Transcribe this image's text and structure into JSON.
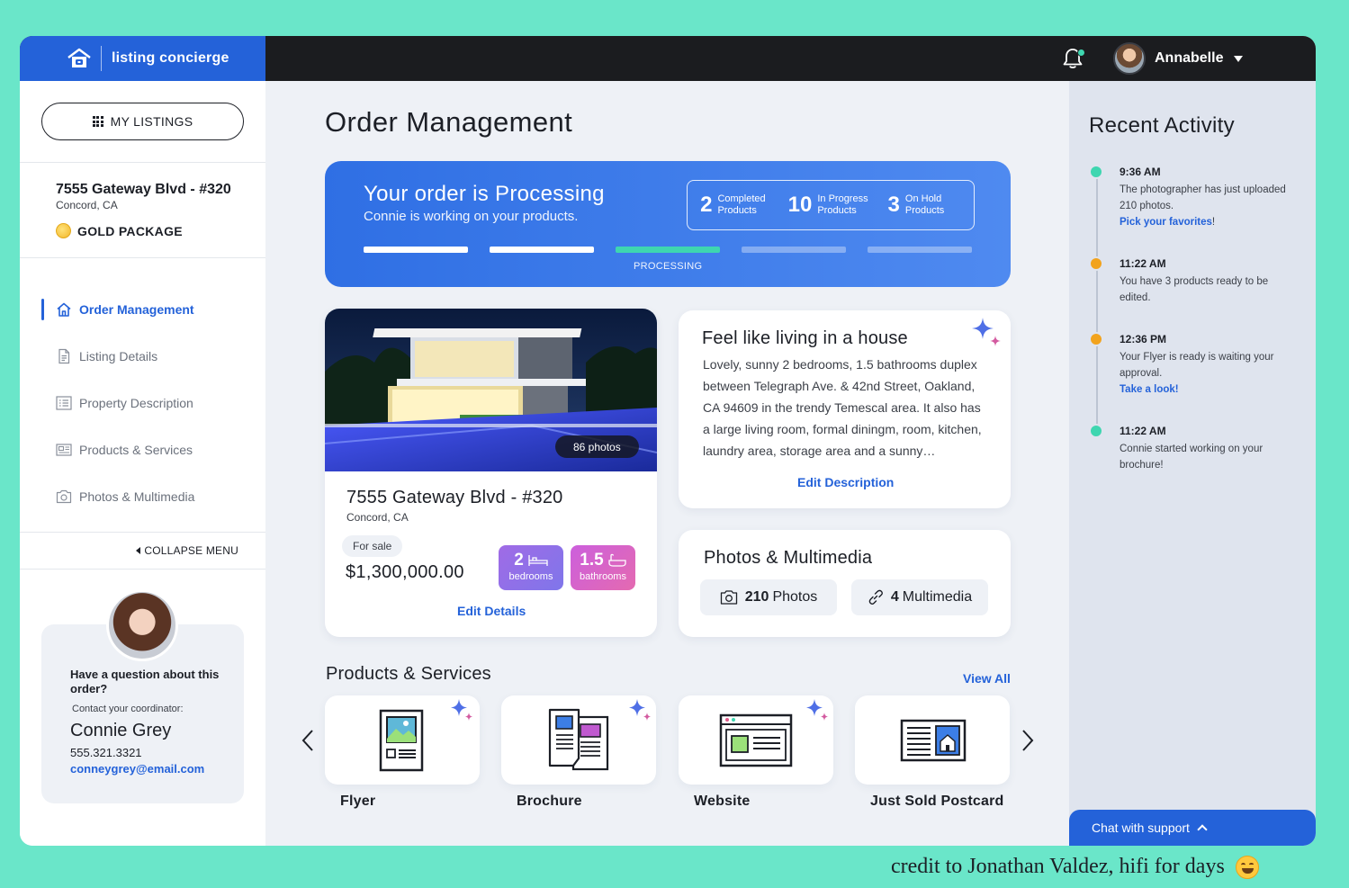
{
  "brand": {
    "name": "listing concierge"
  },
  "header": {
    "user_name": "Annabelle"
  },
  "sidebar": {
    "my_listings_label": "MY LISTINGS",
    "address": "7555 Gateway Blvd - #320",
    "city": "Concord, CA",
    "package": "GOLD PACKAGE",
    "nav": [
      {
        "label": "Order Management",
        "icon": "home-icon",
        "active": true
      },
      {
        "label": "Listing Details",
        "icon": "document-icon"
      },
      {
        "label": "Property Description",
        "icon": "list-icon"
      },
      {
        "label": "Products & Services",
        "icon": "newspaper-icon"
      },
      {
        "label": "Photos & Multimedia",
        "icon": "camera-icon"
      }
    ],
    "collapse_label": "COLLAPSE MENU",
    "coordinator": {
      "question": "Have a question about this order?",
      "contact_label": "Contact your coordinator:",
      "name": "Connie Grey",
      "phone": "555.321.3321",
      "email": "conneygrey@email.com"
    }
  },
  "main": {
    "title": "Order Management",
    "status": {
      "title": "Your order is Processing",
      "subtitle": "Connie is working on your products.",
      "counts": [
        {
          "value": "2",
          "label": "Completed Products"
        },
        {
          "value": "10",
          "label": "In Progress Products"
        },
        {
          "value": "3",
          "label": "On Hold Products"
        }
      ],
      "steps": [
        "done",
        "done",
        "current",
        "pending",
        "pending"
      ],
      "current_step_label": "PROCESSING"
    },
    "listing": {
      "photos_badge": "86 photos",
      "address": "7555 Gateway Blvd - #320",
      "city": "Concord, CA",
      "status": "For sale",
      "price": "$1,300,000.00",
      "bedrooms_value": "2",
      "bedrooms_label": "bedrooms",
      "bathrooms_value": "1.5",
      "bathrooms_label": "bathrooms",
      "edit_label": "Edit Details"
    },
    "description": {
      "title": "Feel like living in a house",
      "body": "Lovely, sunny 2 bedrooms, 1.5 bathrooms duplex between Telegraph Ave. & 42nd Street, Oakland, CA 94609 in the trendy Temescal area. It also has a large living room, formal diningm, room, kitchen, laundry area, storage area and a sunny…",
      "edit_label": "Edit Description"
    },
    "media": {
      "title": "Photos & Multimedia",
      "photos_count": "210",
      "photos_label": "Photos",
      "multimedia_count": "4",
      "multimedia_label": "Multimedia"
    },
    "products": {
      "title": "Products & Services",
      "view_all": "View All",
      "items": [
        {
          "label": "Flyer",
          "icon": "flyer-icon",
          "ai": true
        },
        {
          "label": "Brochure",
          "icon": "brochure-icon",
          "ai": true
        },
        {
          "label": "Website",
          "icon": "website-icon",
          "ai": true
        },
        {
          "label": "Just Sold Postcard",
          "icon": "postcard-icon",
          "ai": false
        }
      ]
    }
  },
  "activity": {
    "title": "Recent Activity",
    "items": [
      {
        "time": "9:36 AM",
        "text": "The photographer has just uploaded 210 photos.",
        "link": "Pick your favorites",
        "link_suffix": "!",
        "color": "#3ed6b0"
      },
      {
        "time": "11:22 AM",
        "text": "You have 3 products ready to be edited.",
        "link": "",
        "link_suffix": "",
        "color": "#f2a31d"
      },
      {
        "time": "12:36 PM",
        "text": "Your Flyer is ready is waiting your approval.",
        "link": "Take a look!",
        "link_suffix": "",
        "color": "#f2a31d"
      },
      {
        "time": "11:22 AM",
        "text": "Connie started working on your brochure!",
        "link": "",
        "link_suffix": "",
        "color": "#3ed6b0"
      }
    ]
  },
  "chat": {
    "label": "Chat with support"
  },
  "credit": {
    "text": "credit to Jonathan Valdez, hifi for days"
  },
  "colors": {
    "brand_blue": "#2462d9",
    "teal": "#3ed6b0",
    "amber": "#f2a31d",
    "background": "#6ae6c9"
  }
}
